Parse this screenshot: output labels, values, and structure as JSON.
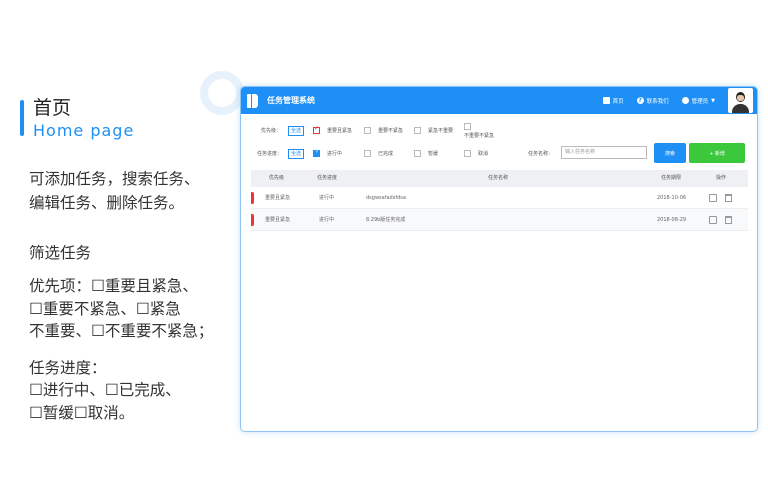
{
  "page": {
    "title_cn": "首页",
    "title_en": "Home page",
    "desc_lines": [
      "可添加任务，搜索任务、",
      "编辑任务、删除任务。"
    ],
    "filter_heading": "筛选任务",
    "priority_lines": [
      "优先项：☐重要且紧急、",
      "☐重要不紧急、☐紧急",
      "不重要、☐不重要不紧急；"
    ],
    "progress_lines": [
      "任务进度：",
      "☐进行中、☐已完成、",
      "☐暂缓☐取消。"
    ]
  },
  "app": {
    "title": "任务管理系统",
    "nav": {
      "home": "首页",
      "contact": "联系我们",
      "admin": "管理员"
    },
    "filters": {
      "priority_label": "优先级：",
      "priority_all": "全选",
      "priority_options": [
        "重要且紧急",
        "重要不紧急",
        "紧急不重要",
        "不重要不紧急"
      ],
      "progress_label": "任务进度：",
      "progress_all": "全选",
      "progress_options": [
        "进行中",
        "已完成",
        "暂缓",
        "取消"
      ],
      "name_label": "任务名称：",
      "name_placeholder": "输入任务名称",
      "search_label": "搜索",
      "new_label": "+ 新增"
    },
    "table": {
      "headers": [
        "优先级",
        "任务进度",
        "任务名称",
        "任务期限",
        "操作"
      ],
      "rows": [
        {
          "priority": "重要且紧急",
          "progress": "进行中",
          "name": "dsgwsafadsfdsa",
          "deadline": "2018-10-06"
        },
        {
          "priority": "重要且紧急",
          "progress": "进行中",
          "name": "8.29b版任务完成",
          "deadline": "2018-08-29"
        }
      ]
    }
  },
  "colors": {
    "accent": "#1e8ff5",
    "new_button": "#3cc83c",
    "priority_mark": "#e33333"
  }
}
